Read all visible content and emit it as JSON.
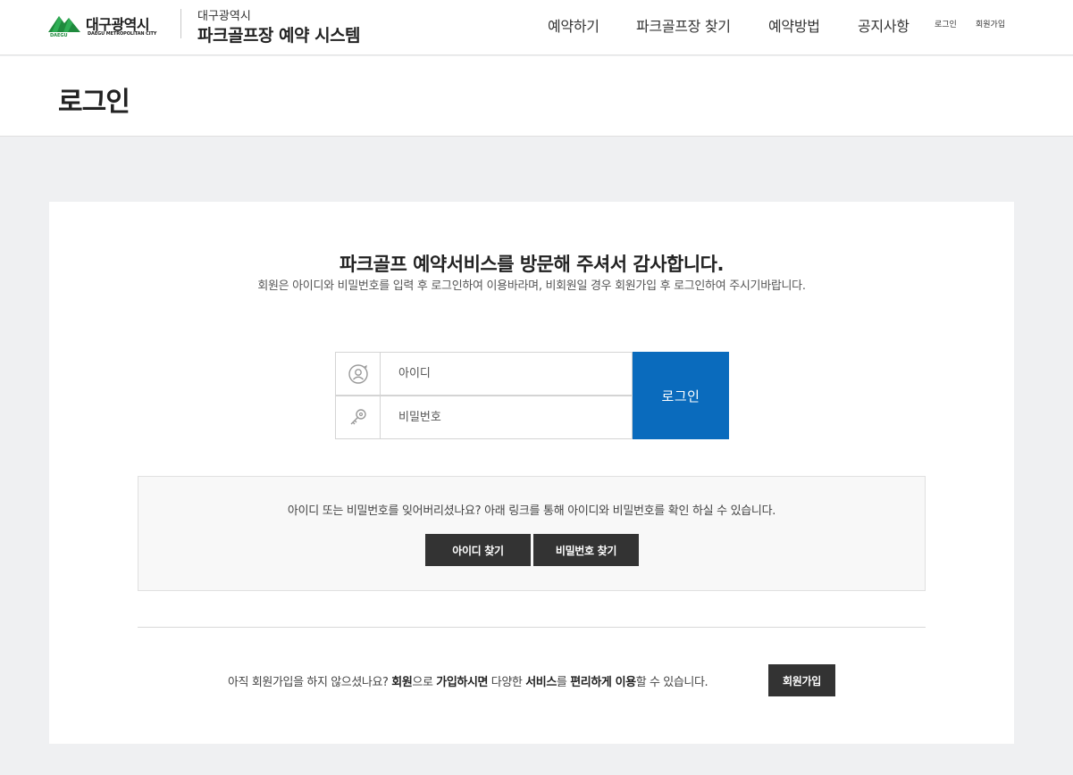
{
  "header": {
    "logo_text": "대구광역시",
    "logo_subtext": "DAEGU METROPOLITAN CITY",
    "logo_badge": "DAEGU",
    "site_city": "대구광역시",
    "site_name": "파크골프장 예약 시스템",
    "nav": [
      "예약하기",
      "파크골프장 찾기",
      "예약방법",
      "공지사항"
    ],
    "util": {
      "login": "로그인",
      "join": "회원가입"
    }
  },
  "page": {
    "title": "로그인"
  },
  "welcome": {
    "title": "파크골프 예약서비스를 방문해 주셔서 감사합니다.",
    "subtitle": "회원은 아이디와 비밀번호를 입력 후 로그인하여 이용바라며, 비회원일 경우 회원가입 후 로그인하여 주시기바랍니다."
  },
  "login_form": {
    "id_placeholder": "아이디",
    "password_placeholder": "비밀번호",
    "id_icon": "user-icon",
    "password_icon": "key-icon",
    "submit_label": "로그인"
  },
  "find_account": {
    "text": "아이디 또는 비밀번호를 잊어버리셨나요? 아래 링크를 통해 아이디와 비밀번호를 확인 하실 수 있습니다.",
    "find_id_label": "아이디 찾기",
    "find_password_label": "비밀번호 찾기"
  },
  "join": {
    "text_part1": "아직 회원가입을 하지 않으셨나요? ",
    "text_bold1": "회원",
    "text_part2": "으로 ",
    "text_bold2": "가입하시면",
    "text_part3": " 다양한 ",
    "text_bold3": "서비스",
    "text_part4": "를 ",
    "text_bold4": "편리하게 이용",
    "text_part5": "할 수 있습니다.",
    "button_label": "회원가입"
  },
  "colors": {
    "accent": "#0a6bbd",
    "dark_button": "#333333",
    "logo_green": "#1f8a3d"
  }
}
